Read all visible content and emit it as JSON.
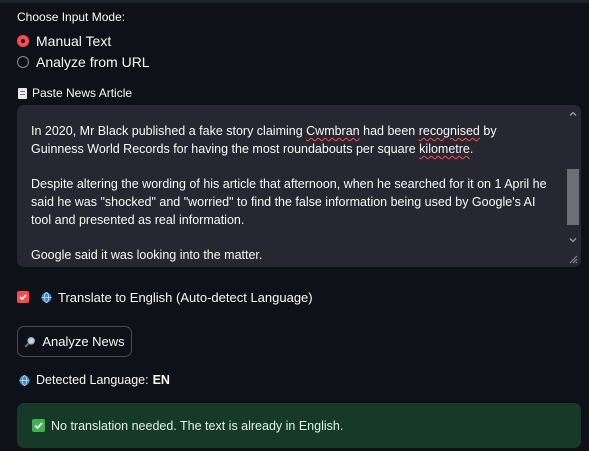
{
  "input_mode": {
    "label": "Choose Input Mode:",
    "options": [
      {
        "label": "Manual Text",
        "selected": true
      },
      {
        "label": "Analyze from URL",
        "selected": false
      }
    ]
  },
  "article": {
    "label": "Paste News Article",
    "icon": "page-facing-up-icon",
    "paragraphs": [
      "In 2020, Mr Black published a fake story claiming Cwmbran had been recognised by Guinness World Records for having the most roundabouts per square kilometre.",
      "Despite altering the wording of his article that afternoon, when he searched for it on 1 April he said he was \"shocked\" and \"worried\" to find the false information being used by Google's AI tool and presented as real information.",
      "Google said it was looking into the matter."
    ],
    "p1_parts": [
      "In 2020, Mr Black published a fake story claiming ",
      "Cwmbran",
      " had been ",
      "recognised",
      " by Guinness World Records for having the most roundabouts per square ",
      "kilometre",
      "."
    ]
  },
  "translate": {
    "label": "Translate to English (Auto-detect Language)",
    "checked": true,
    "icon": "globe-icon"
  },
  "analyze_button": {
    "label": "Analyze News",
    "icon": "magnifier-icon"
  },
  "detected_language": {
    "label": "Detected Language:",
    "value": "EN",
    "icon": "globe-icon"
  },
  "success_message": {
    "text": "No translation needed. The text is already in English.",
    "icon": "check-mark-icon"
  },
  "colors": {
    "background": "#0e1117",
    "accent": "#ff4b4b",
    "input_bg": "#262730",
    "success_bg": "#173928",
    "success_icon": "#3fb34f"
  }
}
